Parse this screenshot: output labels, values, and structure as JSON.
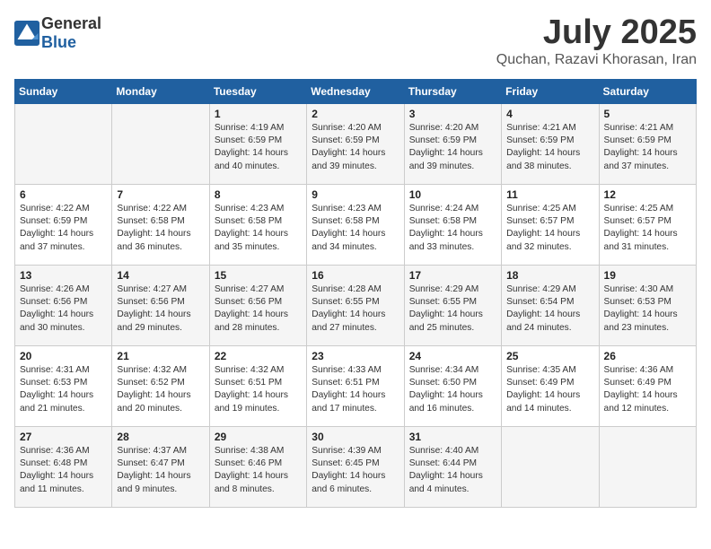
{
  "header": {
    "logo_general": "General",
    "logo_blue": "Blue",
    "month_title": "July 2025",
    "location": "Quchan, Razavi Khorasan, Iran"
  },
  "days_of_week": [
    "Sunday",
    "Monday",
    "Tuesday",
    "Wednesday",
    "Thursday",
    "Friday",
    "Saturday"
  ],
  "weeks": [
    [
      {
        "day": "",
        "info": ""
      },
      {
        "day": "",
        "info": ""
      },
      {
        "day": "1",
        "sunrise": "4:19 AM",
        "sunset": "6:59 PM",
        "daylight": "14 hours and 40 minutes."
      },
      {
        "day": "2",
        "sunrise": "4:20 AM",
        "sunset": "6:59 PM",
        "daylight": "14 hours and 39 minutes."
      },
      {
        "day": "3",
        "sunrise": "4:20 AM",
        "sunset": "6:59 PM",
        "daylight": "14 hours and 39 minutes."
      },
      {
        "day": "4",
        "sunrise": "4:21 AM",
        "sunset": "6:59 PM",
        "daylight": "14 hours and 38 minutes."
      },
      {
        "day": "5",
        "sunrise": "4:21 AM",
        "sunset": "6:59 PM",
        "daylight": "14 hours and 37 minutes."
      }
    ],
    [
      {
        "day": "6",
        "sunrise": "4:22 AM",
        "sunset": "6:59 PM",
        "daylight": "14 hours and 37 minutes."
      },
      {
        "day": "7",
        "sunrise": "4:22 AM",
        "sunset": "6:58 PM",
        "daylight": "14 hours and 36 minutes."
      },
      {
        "day": "8",
        "sunrise": "4:23 AM",
        "sunset": "6:58 PM",
        "daylight": "14 hours and 35 minutes."
      },
      {
        "day": "9",
        "sunrise": "4:23 AM",
        "sunset": "6:58 PM",
        "daylight": "14 hours and 34 minutes."
      },
      {
        "day": "10",
        "sunrise": "4:24 AM",
        "sunset": "6:58 PM",
        "daylight": "14 hours and 33 minutes."
      },
      {
        "day": "11",
        "sunrise": "4:25 AM",
        "sunset": "6:57 PM",
        "daylight": "14 hours and 32 minutes."
      },
      {
        "day": "12",
        "sunrise": "4:25 AM",
        "sunset": "6:57 PM",
        "daylight": "14 hours and 31 minutes."
      }
    ],
    [
      {
        "day": "13",
        "sunrise": "4:26 AM",
        "sunset": "6:56 PM",
        "daylight": "14 hours and 30 minutes."
      },
      {
        "day": "14",
        "sunrise": "4:27 AM",
        "sunset": "6:56 PM",
        "daylight": "14 hours and 29 minutes."
      },
      {
        "day": "15",
        "sunrise": "4:27 AM",
        "sunset": "6:56 PM",
        "daylight": "14 hours and 28 minutes."
      },
      {
        "day": "16",
        "sunrise": "4:28 AM",
        "sunset": "6:55 PM",
        "daylight": "14 hours and 27 minutes."
      },
      {
        "day": "17",
        "sunrise": "4:29 AM",
        "sunset": "6:55 PM",
        "daylight": "14 hours and 25 minutes."
      },
      {
        "day": "18",
        "sunrise": "4:29 AM",
        "sunset": "6:54 PM",
        "daylight": "14 hours and 24 minutes."
      },
      {
        "day": "19",
        "sunrise": "4:30 AM",
        "sunset": "6:53 PM",
        "daylight": "14 hours and 23 minutes."
      }
    ],
    [
      {
        "day": "20",
        "sunrise": "4:31 AM",
        "sunset": "6:53 PM",
        "daylight": "14 hours and 21 minutes."
      },
      {
        "day": "21",
        "sunrise": "4:32 AM",
        "sunset": "6:52 PM",
        "daylight": "14 hours and 20 minutes."
      },
      {
        "day": "22",
        "sunrise": "4:32 AM",
        "sunset": "6:51 PM",
        "daylight": "14 hours and 19 minutes."
      },
      {
        "day": "23",
        "sunrise": "4:33 AM",
        "sunset": "6:51 PM",
        "daylight": "14 hours and 17 minutes."
      },
      {
        "day": "24",
        "sunrise": "4:34 AM",
        "sunset": "6:50 PM",
        "daylight": "14 hours and 16 minutes."
      },
      {
        "day": "25",
        "sunrise": "4:35 AM",
        "sunset": "6:49 PM",
        "daylight": "14 hours and 14 minutes."
      },
      {
        "day": "26",
        "sunrise": "4:36 AM",
        "sunset": "6:49 PM",
        "daylight": "14 hours and 12 minutes."
      }
    ],
    [
      {
        "day": "27",
        "sunrise": "4:36 AM",
        "sunset": "6:48 PM",
        "daylight": "14 hours and 11 minutes."
      },
      {
        "day": "28",
        "sunrise": "4:37 AM",
        "sunset": "6:47 PM",
        "daylight": "14 hours and 9 minutes."
      },
      {
        "day": "29",
        "sunrise": "4:38 AM",
        "sunset": "6:46 PM",
        "daylight": "14 hours and 8 minutes."
      },
      {
        "day": "30",
        "sunrise": "4:39 AM",
        "sunset": "6:45 PM",
        "daylight": "14 hours and 6 minutes."
      },
      {
        "day": "31",
        "sunrise": "4:40 AM",
        "sunset": "6:44 PM",
        "daylight": "14 hours and 4 minutes."
      },
      {
        "day": "",
        "info": ""
      },
      {
        "day": "",
        "info": ""
      }
    ]
  ],
  "labels": {
    "sunrise": "Sunrise: ",
    "sunset": "Sunset: ",
    "daylight": "Daylight: "
  }
}
